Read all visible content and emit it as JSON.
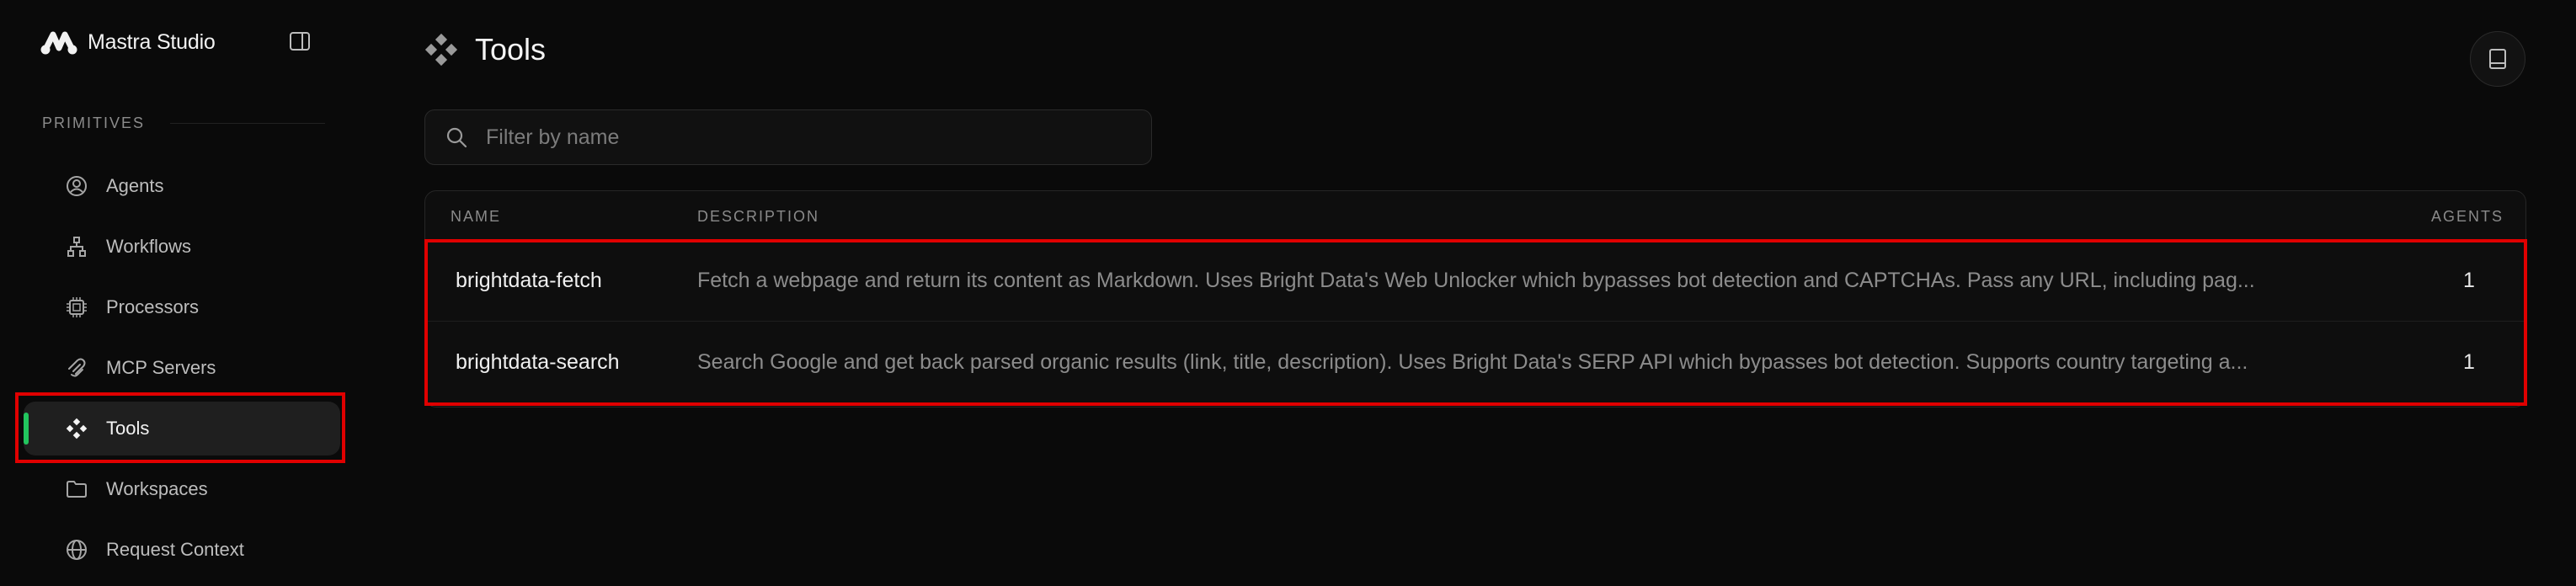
{
  "app": {
    "name": "Mastra Studio"
  },
  "sidebar": {
    "section_label": "PRIMITIVES",
    "items": [
      {
        "label": "Agents",
        "icon": "user-circle-icon"
      },
      {
        "label": "Workflows",
        "icon": "workflow-icon"
      },
      {
        "label": "Processors",
        "icon": "chip-icon"
      },
      {
        "label": "MCP Servers",
        "icon": "mcp-icon"
      },
      {
        "label": "Tools",
        "icon": "tools-icon",
        "active": true
      },
      {
        "label": "Workspaces",
        "icon": "folder-icon"
      },
      {
        "label": "Request Context",
        "icon": "globe-icon"
      }
    ]
  },
  "page": {
    "title": "Tools"
  },
  "search": {
    "placeholder": "Filter by name",
    "value": ""
  },
  "table": {
    "columns": [
      "NAME",
      "DESCRIPTION",
      "AGENTS"
    ],
    "rows": [
      {
        "name": "brightdata-fetch",
        "description": "Fetch a webpage and return its content as Markdown. Uses Bright Data's Web Unlocker which bypasses bot detection and CAPTCHAs. Pass any URL, including pag...",
        "agents": "1"
      },
      {
        "name": "brightdata-search",
        "description": "Search Google and get back parsed organic results (link, title, description). Uses Bright Data's SERP API which bypasses bot detection. Supports country targeting a...",
        "agents": "1"
      }
    ]
  },
  "colors": {
    "accent": "#22c55e",
    "highlight": "#e00000",
    "background": "#0a0a0a"
  }
}
